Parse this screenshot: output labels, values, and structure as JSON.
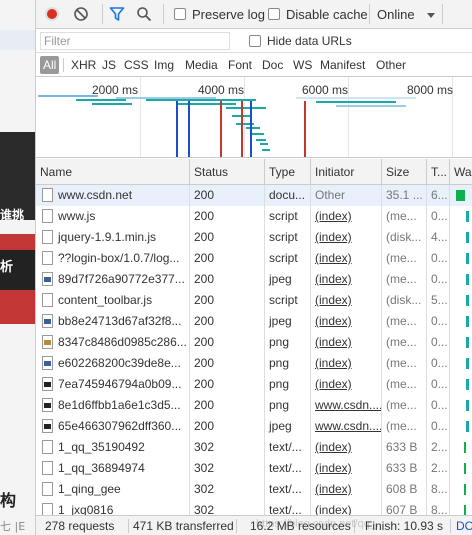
{
  "page_strip": {
    "text_1": "谁挑",
    "text_2": "析",
    "text_3": "构",
    "text_4": "七 |E"
  },
  "toolbar": {
    "preserve_log_label": "Preserve log",
    "disable_cache_label": "Disable cache",
    "throttle_value": "Online"
  },
  "filter": {
    "placeholder": "Filter",
    "hide_data_urls_label": "Hide data URLs"
  },
  "type_filters": [
    "All",
    "XHR",
    "JS",
    "CSS",
    "Img",
    "Media",
    "Font",
    "Doc",
    "WS",
    "Manifest",
    "Other"
  ],
  "overview": {
    "ticks": [
      "2000 ms",
      "4000 ms",
      "6000 ms",
      "8000 ms"
    ]
  },
  "columns": [
    "Name",
    "Status",
    "Type",
    "Initiator",
    "Size",
    "T...",
    "Wa"
  ],
  "rows": [
    {
      "name": "www.csdn.net",
      "status": "200",
      "type": "docu...",
      "initiator": "Other",
      "size": "35.1 ...",
      "time": "6...",
      "icon": "document-icon"
    },
    {
      "name": "www.js",
      "status": "200",
      "type": "script",
      "initiator": "(index)",
      "size": "(me...",
      "time": "0...",
      "icon": "script-icon"
    },
    {
      "name": "jquery-1.9.1.min.js",
      "status": "200",
      "type": "script",
      "initiator": "(index)",
      "size": "(disk...",
      "time": "4...",
      "icon": "script-icon"
    },
    {
      "name": "??login-box/1.0.7/log...",
      "status": "200",
      "type": "script",
      "initiator": "(index)",
      "size": "(me...",
      "time": "0...",
      "icon": "script-icon"
    },
    {
      "name": "89d7f726a90772e377...",
      "status": "200",
      "type": "jpeg",
      "initiator": "(index)",
      "size": "(me...",
      "time": "0...",
      "icon": "image-icon"
    },
    {
      "name": "content_toolbar.js",
      "status": "200",
      "type": "script",
      "initiator": "(index)",
      "size": "(disk...",
      "time": "5...",
      "icon": "script-icon"
    },
    {
      "name": "bb8e24713d67af32f8...",
      "status": "200",
      "type": "jpeg",
      "initiator": "(index)",
      "size": "(me...",
      "time": "0...",
      "icon": "image-icon"
    },
    {
      "name": "8347c8486d0985c286...",
      "status": "200",
      "type": "png",
      "initiator": "(index)",
      "size": "(me...",
      "time": "0...",
      "icon": "image-icon"
    },
    {
      "name": "e602268200c39de8e...",
      "status": "200",
      "type": "png",
      "initiator": "(index)",
      "size": "(me...",
      "time": "0...",
      "icon": "image-icon"
    },
    {
      "name": "7ea745946794a0b09...",
      "status": "200",
      "type": "png",
      "initiator": "(index)",
      "size": "(me...",
      "time": "0...",
      "icon": "image-icon"
    },
    {
      "name": "8e1d6ffbb1a6e1c3d5...",
      "status": "200",
      "type": "png",
      "initiator": "www.csdn....",
      "size": "(me...",
      "time": "0...",
      "icon": "image-icon"
    },
    {
      "name": "65e466307962dff360...",
      "status": "200",
      "type": "jpeg",
      "initiator": "www.csdn....",
      "size": "(me...",
      "time": "0...",
      "icon": "image-icon"
    },
    {
      "name": "1_qq_35190492",
      "status": "302",
      "type": "text/...",
      "initiator": "(index)",
      "size": "633 B",
      "time": "2...",
      "icon": "document-icon"
    },
    {
      "name": "1_qq_36894974",
      "status": "302",
      "type": "text/...",
      "initiator": "(index)",
      "size": "633 B",
      "time": "2...",
      "icon": "document-icon"
    },
    {
      "name": "1_qing_gee",
      "status": "302",
      "type": "text/...",
      "initiator": "(index)",
      "size": "608 B",
      "time": "8...",
      "icon": "document-icon"
    },
    {
      "name": "1_jxq0816",
      "status": "302",
      "type": "text/...",
      "initiator": "(index)",
      "size": "607 B",
      "time": "8...",
      "icon": "document-icon"
    }
  ],
  "status_bar": {
    "requests": "278 requests",
    "transferred": "471 KB transferred",
    "resources": "16.2 MB resources",
    "finish": "Finish: 10.93 s",
    "trailing": "DO",
    "watermark": "https://blog.csdn.net/qq_..."
  },
  "colors": {
    "record": "#d93025",
    "filter_icon": "#1a73e8",
    "waterfall_bar": "#1aa8a8",
    "waterfall_doc": "#0db14b",
    "marker_red": "#c0392b",
    "marker_blue": "#1a4ecf"
  }
}
